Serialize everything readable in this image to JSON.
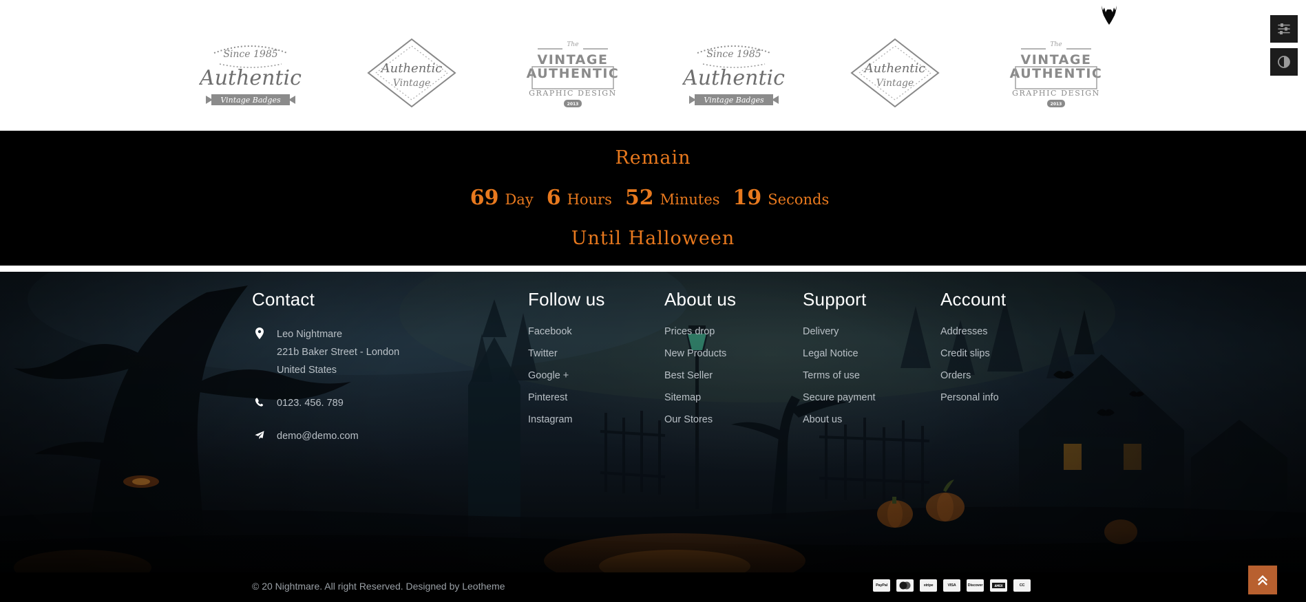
{
  "brand_strip": {
    "logos": [
      {
        "id": "authentic-vintage-badges",
        "since": "Since 1985",
        "name": "Authentic",
        "ribbon": "Vintage Badges"
      },
      {
        "id": "authentic-vintage-diamond",
        "line1": "Authentic",
        "line2": "Vintage"
      },
      {
        "id": "vintage-authentic-graphic-design",
        "the": "The",
        "line1": "VINTAGE",
        "line2": "AUTHENTIC",
        "line3": "GRAPHIC DESIGN",
        "year": "2013"
      },
      {
        "id": "authentic-vintage-badges",
        "since": "Since 1985",
        "name": "Authentic",
        "ribbon": "Vintage Badges"
      },
      {
        "id": "authentic-vintage-diamond",
        "line1": "Authentic",
        "line2": "Vintage"
      },
      {
        "id": "vintage-authentic-graphic-design",
        "the": "The",
        "line1": "VINTAGE",
        "line2": "AUTHENTIC",
        "line3": "GRAPHIC DESIGN",
        "year": "2013"
      }
    ]
  },
  "tools": {
    "settings_icon": "sliders-icon",
    "contrast_icon": "contrast-icon"
  },
  "decor": {
    "bat_icon": "bat-icon"
  },
  "countdown": {
    "title": "Remain",
    "days": "69",
    "days_label": "Day",
    "hours": "6",
    "hours_label": "Hours",
    "minutes": "52",
    "minutes_label": "Minutes",
    "seconds": "19",
    "seconds_label": "Seconds",
    "footer_text": "Until Halloween",
    "accent_color": "#e8791e",
    "background_color": "#000000"
  },
  "footer": {
    "contact": {
      "title": "Contact",
      "address_icon": "location-pin-icon",
      "address_lines": [
        "Leo Nightmare",
        "221b Baker Street - London",
        "United States"
      ],
      "phone_icon": "phone-icon",
      "phone": "0123. 456. 789",
      "email_icon": "paper-plane-icon",
      "email": "demo@demo.com"
    },
    "follow": {
      "title": "Follow us",
      "links": [
        "Facebook",
        "Twitter",
        "Google +",
        "Pinterest",
        "Instagram"
      ]
    },
    "about": {
      "title": "About us",
      "links": [
        "Prices drop",
        "New Products",
        "Best Seller",
        "Sitemap",
        "Our Stores"
      ]
    },
    "support": {
      "title": "Support",
      "links": [
        "Delivery",
        "Legal Notice",
        "Terms of use",
        "Secure payment",
        "About us"
      ]
    },
    "account": {
      "title": "Account",
      "links": [
        "Addresses",
        "Credit slips",
        "Orders",
        "Personal info"
      ]
    }
  },
  "copyright": {
    "text": "© 20   Nightmare. All right Reserved. Designed by Leotheme",
    "payment_methods": [
      "PayPal",
      "Mastercard",
      "stripe",
      "VISA",
      "Discover",
      "American Express",
      "CC"
    ]
  },
  "scroll_top": {
    "icon": "double-chevron-up-icon",
    "color": "#b8602f"
  }
}
